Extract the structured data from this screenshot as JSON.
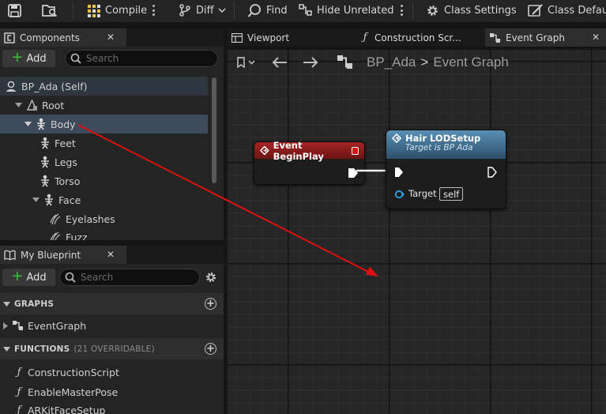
{
  "toolbar": {
    "compile_label": "Compile",
    "diff_label": "Diff",
    "find_label": "Find",
    "hide_unrelated_label": "Hide Unrelated",
    "class_settings_label": "Class Settings",
    "class_defaults_label": "Class Default"
  },
  "components": {
    "tab_label": "Components",
    "add_label": "Add",
    "search_placeholder": "Search",
    "tree": [
      {
        "label": "BP_Ada (Self)"
      },
      {
        "label": "Root"
      },
      {
        "label": "Body"
      },
      {
        "label": "Feet"
      },
      {
        "label": "Legs"
      },
      {
        "label": "Torso"
      },
      {
        "label": "Face"
      },
      {
        "label": "Eyelashes"
      },
      {
        "label": "Fuzz"
      }
    ]
  },
  "my_blueprint": {
    "tab_label": "My Blueprint",
    "add_label": "Add",
    "search_placeholder": "Search",
    "graphs_header": "GRAPHS",
    "graphs": [
      {
        "label": "EventGraph"
      }
    ],
    "functions_header": "FUNCTIONS",
    "functions_count": "(21 OVERRIDABLE)",
    "functions": [
      {
        "label": "ConstructionScript"
      },
      {
        "label": "EnableMasterPose"
      },
      {
        "label": "ARKitFaceSetup"
      }
    ]
  },
  "editor_tabs": [
    {
      "label": "Viewport"
    },
    {
      "label": "Construction Scr..."
    },
    {
      "label": "Event Graph"
    }
  ],
  "breadcrumb": {
    "blueprint": "BP_Ada",
    "separator": ">",
    "graph": "Event Graph"
  },
  "nodes": {
    "begin_play": {
      "title": "Event BeginPlay",
      "color": "#8e1b1b"
    },
    "hair_lod": {
      "title": "Hair LODSetup",
      "subtitle": "Target is BP Ada",
      "target_label": "Target",
      "target_value": "self",
      "color": "#3d6a8a"
    }
  },
  "annotation_arrow_color": "#e01010"
}
